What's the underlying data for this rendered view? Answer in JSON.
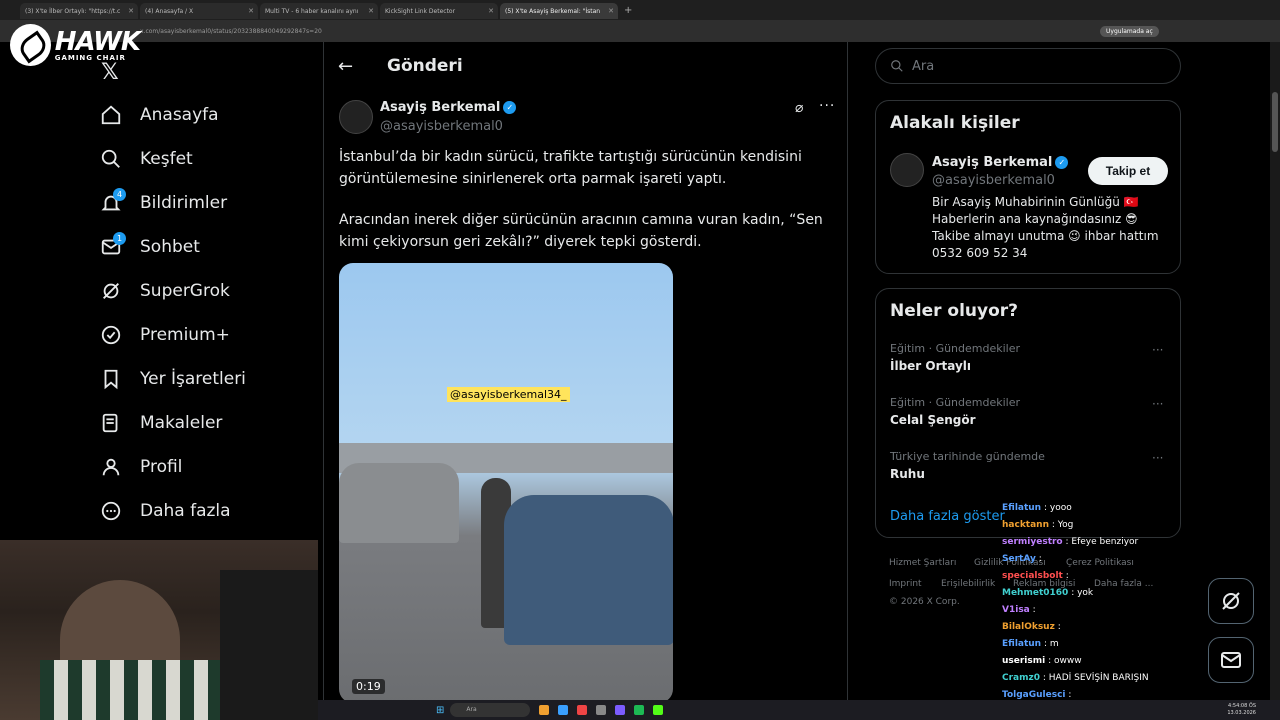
{
  "browser": {
    "tabs": [
      {
        "title": "(3) X'te İlber Ortaylı: \"https://t.c"
      },
      {
        "title": "(4) Anasayfa / X"
      },
      {
        "title": "Multi TV - 6 haber kanalını aynı"
      },
      {
        "title": "KickSight Link Detector"
      },
      {
        "title": "(5) X'te Asayiş Berkemal: \"İstan"
      }
    ],
    "url": "x.com/asayisberkemal0/status/2032388840049292847s=20",
    "app_pill": "Uygulamada aç"
  },
  "overlay": {
    "logo_big": "HAWK",
    "logo_small": "GAMING CHAIR"
  },
  "nav": {
    "items": [
      {
        "label": "Anasayfa"
      },
      {
        "label": "Keşfet"
      },
      {
        "label": "Bildirimler",
        "badge": "4"
      },
      {
        "label": "Sohbet",
        "badge": "1"
      },
      {
        "label": "SuperGrok"
      },
      {
        "label": "Premium+"
      },
      {
        "label": "Yer İşaretleri"
      },
      {
        "label": "Makaleler"
      },
      {
        "label": "Profil"
      },
      {
        "label": "Daha fazla"
      }
    ]
  },
  "post": {
    "header": "Gönderi",
    "author": "Asayiş Berkemal",
    "handle": "@asayisberkemal0",
    "text1": "İstanbul’da bir kadın sürücü, trafikte tartıştığı sürücünün kendisini görüntülemesine sinirlenerek orta parmak işareti yaptı.",
    "text2": "Aracından inerek diğer sürücünün aracının camına vuran kadın, “Sen kimi çekiyorsun geri zekâlı?” diyerek tepki gösterdi.",
    "watermark": "@asayisberkemal34_",
    "duration": "0:19"
  },
  "right": {
    "search_placeholder": "Ara",
    "related": {
      "title": "Alakalı kişiler",
      "name": "Asayiş Berkemal",
      "handle": "@asayisberkemal0",
      "follow": "Takip et",
      "bio": [
        "Bir Asayiş Muhabirinin Günlüğü 🇹🇷",
        "Haberlerin ana kaynağındasınız 😎",
        "Takibe almayı unutma 😉 ihbar hattım",
        "0532 609 52 34"
      ]
    },
    "trends": {
      "title": "Neler oluyor?",
      "items": [
        {
          "meta": "Eğitim · Gündemdekiler",
          "name": "İlber Ortaylı"
        },
        {
          "meta": "Eğitim · Gündemdekiler",
          "name": "Celal Şengör"
        },
        {
          "meta": "Türkiye tarihinde gündemde",
          "name": "Ruhu"
        }
      ],
      "show_more": "Daha fazla göster"
    },
    "footer": {
      "terms": "Hizmet Şartları",
      "privacy": "Gizlilik Politikası",
      "cookies": "Çerez Politikası",
      "imprint": "Imprint",
      "access": "Erişilebilirlik",
      "ads": "Reklam bilgisi",
      "more": "Daha fazla ...",
      "copy": "© 2026 X Corp."
    }
  },
  "chat": [
    {
      "user": "Efilatun",
      "msg": ": yooo",
      "color": "#5aa0ff"
    },
    {
      "user": "hacktann",
      "msg": ": Yog",
      "color": "#f0a030"
    },
    {
      "user": "sermiyestro",
      "msg": ": Efeye benziyor",
      "color": "#c080ff"
    },
    {
      "user": "SertAy",
      "msg": ":",
      "color": "#5aa0ff"
    },
    {
      "user": "specialsbolt",
      "msg": ":",
      "color": "#ff5050"
    },
    {
      "user": "Mehmet0160",
      "msg": ": yok",
      "color": "#40d0d0"
    },
    {
      "user": "V1isa",
      "msg": ":",
      "color": "#c080ff"
    },
    {
      "user": "BilalOksuz",
      "msg": ":",
      "color": "#f0a030"
    },
    {
      "user": "Efilatun",
      "msg": ": m",
      "color": "#5aa0ff"
    },
    {
      "user": "userismi",
      "msg": ": owww",
      "color": "#ffffff"
    },
    {
      "user": "Cramz0",
      "msg": ": HADİ SEVİŞİN BARIŞIN",
      "color": "#40d0d0"
    },
    {
      "user": "TolgaGulesci",
      "msg": ":",
      "color": "#5aa0ff"
    }
  ],
  "taskbar": {
    "search": "Ara",
    "time": "4:54:08 ÖS",
    "date": "13.03.2026"
  },
  "colors": {
    "accent": "#1d9bf0",
    "border": "#2f3336",
    "muted": "#71767b"
  }
}
